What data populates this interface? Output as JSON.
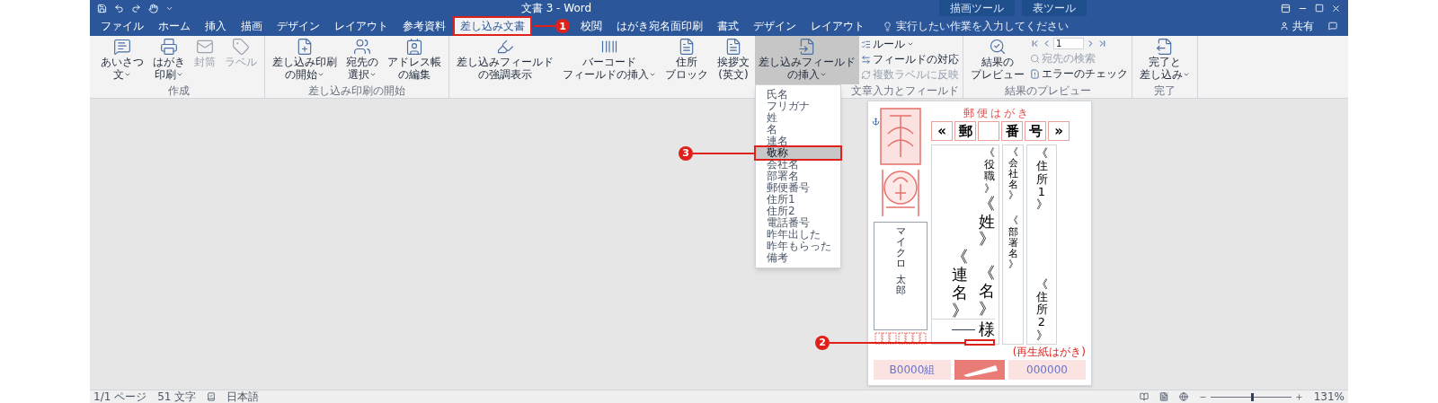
{
  "title_bar": {
    "title": "文書 3 - Word",
    "context_labels": [
      {
        "label": "描画ツール"
      },
      {
        "label": "表ツール"
      }
    ]
  },
  "tabs": [
    {
      "label": "ファイル",
      "selected": false
    },
    {
      "label": "ホーム",
      "selected": false
    },
    {
      "label": "挿入",
      "selected": false
    },
    {
      "label": "描画",
      "selected": false
    },
    {
      "label": "デザイン",
      "selected": false
    },
    {
      "label": "レイアウト",
      "selected": false
    },
    {
      "label": "参考資料",
      "selected": false
    },
    {
      "label": "差し込み文書",
      "selected": true,
      "callout": "1"
    },
    {
      "label": "校閲",
      "selected": false
    },
    {
      "label": "はがき宛名面印刷",
      "selected": false
    },
    {
      "label": "書式",
      "selected": false
    },
    {
      "label": "デザイン",
      "selected": false
    },
    {
      "label": "レイアウト",
      "selected": false
    }
  ],
  "search": {
    "placeholder": "実行したい作業を入力してください"
  },
  "share": {
    "label": "共有"
  },
  "ribbon": {
    "groups": [
      {
        "label": "作成",
        "items": [
          {
            "kind": "large",
            "lines": [
              "あいさつ",
              "文"
            ],
            "dropdown": true,
            "disabled": false,
            "pressed": false
          },
          {
            "kind": "large",
            "lines": [
              "はがき",
              "印刷"
            ],
            "dropdown": true,
            "disabled": false,
            "pressed": false
          },
          {
            "kind": "large",
            "lines": [
              "封筒"
            ],
            "dropdown": false,
            "disabled": true,
            "pressed": false
          },
          {
            "kind": "large",
            "lines": [
              "ラベル"
            ],
            "dropdown": false,
            "disabled": true,
            "pressed": false
          }
        ]
      },
      {
        "label": "差し込み印刷の開始",
        "items": [
          {
            "kind": "large",
            "lines": [
              "差し込み印刷",
              "の開始"
            ],
            "dropdown": true,
            "disabled": false,
            "pressed": false
          },
          {
            "kind": "large",
            "lines": [
              "宛先の",
              "選択"
            ],
            "dropdown": true,
            "disabled": false,
            "pressed": false
          },
          {
            "kind": "large",
            "lines": [
              "アドレス帳",
              "の編集"
            ],
            "dropdown": false,
            "disabled": false,
            "pressed": false
          }
        ]
      },
      {
        "label": "文章入力とフィールド",
        "items": [
          {
            "kind": "large",
            "lines": [
              "差し込みフィールド",
              "の強調表示"
            ],
            "dropdown": false,
            "disabled": false,
            "pressed": false
          },
          {
            "kind": "large",
            "lines": [
              "バーコード",
              "フィールドの挿入"
            ],
            "dropdown": true,
            "disabled": false,
            "pressed": false
          },
          {
            "kind": "large",
            "lines": [
              "住所",
              "ブロック"
            ],
            "dropdown": false,
            "disabled": false,
            "pressed": false
          },
          {
            "kind": "large",
            "lines": [
              "挨拶文",
              "(英文)"
            ],
            "dropdown": false,
            "disabled": false,
            "pressed": false
          },
          {
            "kind": "large",
            "lines": [
              "差し込みフィールド",
              "の挿入"
            ],
            "dropdown": true,
            "disabled": false,
            "pressed": true,
            "menu": {
              "items": [
                {
                  "label": "氏名",
                  "selected": false
                },
                {
                  "label": "フリガナ",
                  "selected": false
                },
                {
                  "label": "姓",
                  "selected": false
                },
                {
                  "label": "名",
                  "selected": false
                },
                {
                  "label": "連名",
                  "selected": false
                },
                {
                  "label": "敬称",
                  "selected": true,
                  "callout": "3"
                },
                {
                  "label": "会社名",
                  "selected": false
                },
                {
                  "label": "部署名",
                  "selected": false
                },
                {
                  "label": "郵便番号",
                  "selected": false
                },
                {
                  "label": "住所1",
                  "selected": false
                },
                {
                  "label": "住所2",
                  "selected": false
                },
                {
                  "label": "電話番号",
                  "selected": false
                },
                {
                  "label": "昨年出した",
                  "selected": false
                },
                {
                  "label": "昨年もらった",
                  "selected": false
                },
                {
                  "label": "備考",
                  "selected": false
                }
              ]
            }
          },
          {
            "kind": "stack",
            "items": [
              {
                "kind": "small",
                "label": "ルール",
                "dropdown": true,
                "disabled": false
              },
              {
                "kind": "small",
                "label": "フィールドの対応",
                "dropdown": false,
                "disabled": false
              },
              {
                "kind": "small",
                "label": "複数ラベルに反映",
                "dropdown": false,
                "disabled": true
              }
            ]
          }
        ]
      },
      {
        "label": "結果のプレビュー",
        "items": [
          {
            "kind": "large",
            "lines": [
              "結果の",
              "プレビュー"
            ],
            "dropdown": false,
            "disabled": false,
            "pressed": false
          },
          {
            "kind": "stack",
            "items": [
              {
                "kind": "record-nav",
                "value": "1"
              },
              {
                "kind": "small",
                "label": "宛先の検索",
                "dropdown": false,
                "disabled": true
              },
              {
                "kind": "small",
                "label": "エラーのチェック",
                "dropdown": false,
                "disabled": false
              }
            ]
          }
        ]
      },
      {
        "label": "完了",
        "items": [
          {
            "kind": "large",
            "lines": [
              "完了と",
              "差し込み"
            ],
            "dropdown": true,
            "disabled": false,
            "pressed": false
          }
        ]
      }
    ]
  },
  "postcard": {
    "header": "郵便はがき",
    "postal_boxes": [
      {
        "kind": "char",
        "text": "«"
      },
      {
        "kind": "char",
        "text": "郵"
      },
      {
        "kind": "blank"
      },
      {
        "kind": "char",
        "text": "番"
      },
      {
        "kind": "char",
        "text": "号"
      },
      {
        "kind": "char",
        "text": "»"
      }
    ],
    "sender": [
      "マイクロ",
      "太郎"
    ],
    "title_field": "《役職》",
    "last_name": "《姓》",
    "joint_name": "《連名》",
    "first_name": "《名》",
    "honorific": "様",
    "honorific_callout": "2",
    "company": "《会社名》",
    "department": "《部署名》",
    "address_1": "《住所1》",
    "address_2": "《住所2》",
    "note": "(再生紙はがき)",
    "lottery_group": "B0000組",
    "lottery_number": "000000"
  },
  "status_bar": {
    "page": "1/1 ページ",
    "words": "51 文字",
    "language": "日本語",
    "zoom_slider": {
      "level": 0.5
    },
    "zoom": "131%"
  }
}
